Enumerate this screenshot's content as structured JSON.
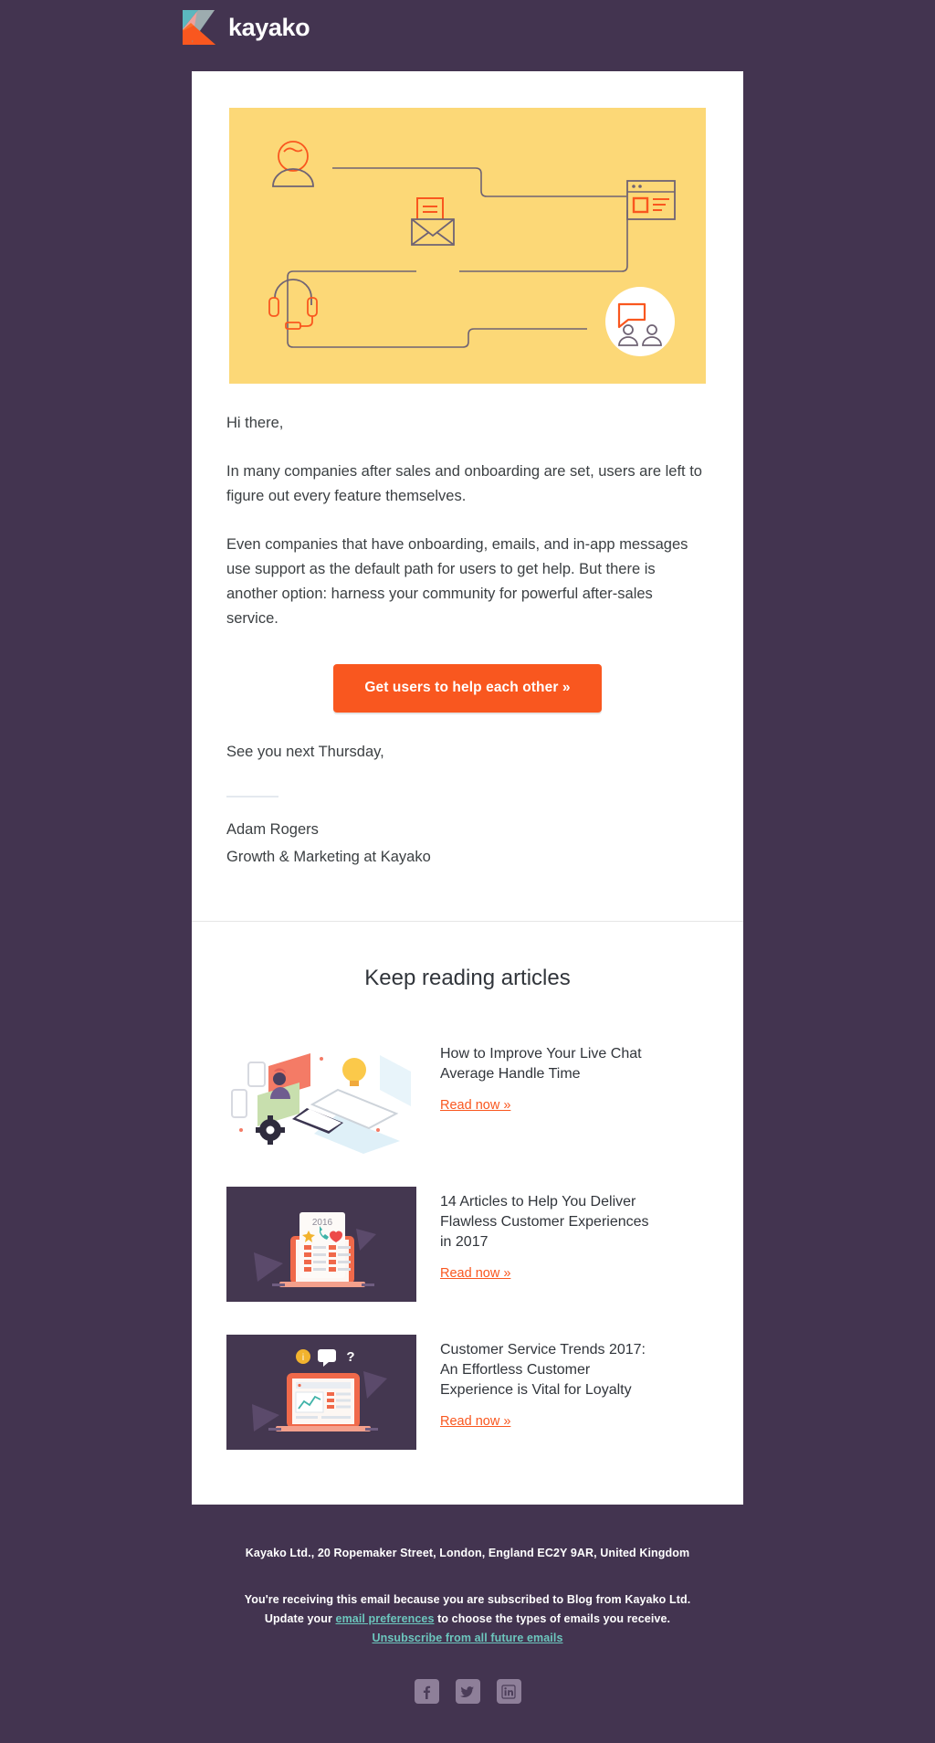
{
  "header": {
    "brand_name": "kayako",
    "logo_icon": "kayako-k-logo",
    "background_color": "#433450",
    "logo_colors": {
      "teal": "#5bb7bf",
      "pink": "#f7a8a0",
      "orange": "#f9571f",
      "orange_light": "#fb8333"
    }
  },
  "hero": {
    "background_color": "#fcd877",
    "line_color": "#6f6374",
    "accent_color": "#f9571f",
    "icons": [
      "user-avatar-icon",
      "browser-window-icon",
      "envelope-mail-icon",
      "headset-support-icon",
      "community-chat-icon"
    ]
  },
  "body": {
    "greeting": "Hi there,",
    "paragraphs": [
      "In many companies after sales and onboarding are set, users are left to figure out every feature themselves.",
      "Even companies that have onboarding, emails, and in-app messages use support as the default path for users to get help. But there is another option: harness your community for powerful after-sales service."
    ],
    "cta_label": "Get users to help each other »",
    "cta_color": "#f9571f",
    "signoff": "See you next Thursday,",
    "signature_name": "Adam Rogers",
    "signature_role": "Growth & Marketing at Kayako"
  },
  "articles": {
    "section_title": "Keep reading articles",
    "items": [
      {
        "title": "How to Improve Your Live Chat Average Handle Time",
        "link_label": "Read now »",
        "thumbnail": "live-chat-devices-illustration"
      },
      {
        "title": "14 Articles to Help You Deliver Flawless Customer Experiences in 2017",
        "link_label": "Read now »",
        "thumbnail": "laptop-checklist-2016-illustration",
        "thumbnail_text": "2016"
      },
      {
        "title": "Customer Service Trends 2017: An Effortless Customer Experience is Vital for Loyalty",
        "link_label": "Read now »",
        "thumbnail": "laptop-dashboard-illustration"
      }
    ]
  },
  "footer": {
    "address": "Kayako Ltd., 20 Ropemaker Street, London, England EC2Y 9AR, United Kingdom",
    "subscription_notice": "You're receiving this email because you are subscribed to Blog from Kayako Ltd.",
    "preferences_prefix": "Update your ",
    "preferences_link": "email preferences",
    "preferences_suffix": " to choose the types of emails you receive.",
    "unsubscribe_link": "Unsubscribe from all future emails",
    "link_color": "#6cc6bd",
    "social": [
      {
        "name": "facebook",
        "glyph": "f"
      },
      {
        "name": "twitter",
        "glyph": "t"
      },
      {
        "name": "linkedin",
        "glyph": "in"
      }
    ]
  }
}
